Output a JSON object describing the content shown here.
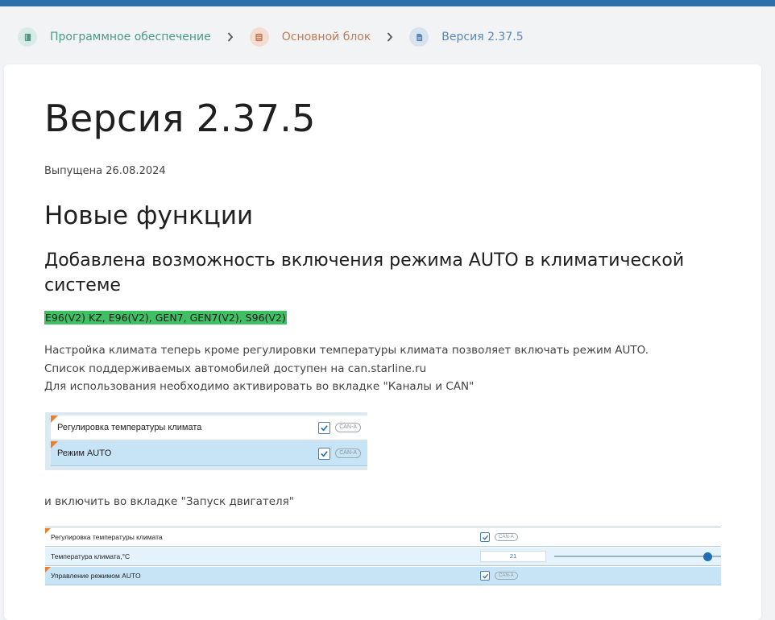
{
  "breadcrumbs": [
    {
      "label": "Программное обеспечение",
      "icon": "book-icon"
    },
    {
      "label": "Основной блок",
      "icon": "list-icon"
    },
    {
      "label": "Версия 2.37.5",
      "icon": "document-icon"
    }
  ],
  "article": {
    "title": "Версия 2.37.5",
    "released": "Выпущена 26.08.2024",
    "section_title": "Новые функции",
    "feature_title": "Добавлена возможность включения режима AUTO в климатической системе",
    "devices_tag": "E96(V2) KZ, E96(V2), GEN7, GEN7(V2), S96(V2)",
    "description_lines": [
      "Настройка климата теперь кроме регулировки температуры климата позволяет включать режим AUTO. Список поддерживаемых автомобилей доступен на can.starline.ru",
      "Для использования необходимо активировать во вкладке \"Каналы и CAN\""
    ],
    "description_2": "и включить во вкладке \"Запуск двигателя\""
  },
  "screenshot_channels": {
    "rows": [
      {
        "label": "Регулировка температуры климата",
        "checked": true,
        "badge": "CAN-A"
      },
      {
        "label": "Режим AUTO",
        "checked": true,
        "badge": "CAN-A"
      }
    ]
  },
  "screenshot_engine_start": {
    "rows": [
      {
        "label": "Регулировка температуры климата",
        "checked": true,
        "badge": "CAN-A"
      },
      {
        "label": "Температура климата,°C",
        "value": "21",
        "slider_fraction": 0.92
      },
      {
        "label": "Управление режимом AUTO",
        "checked": true,
        "badge": "CAN-A"
      }
    ]
  },
  "colors": {
    "topbar": "#2d6fa8",
    "tag_highlight": "#3fc065",
    "crumb_1": "#4a9a86",
    "crumb_2": "#c07a57",
    "crumb_3": "#5a87b3",
    "accent_corner": "#e8802c"
  }
}
